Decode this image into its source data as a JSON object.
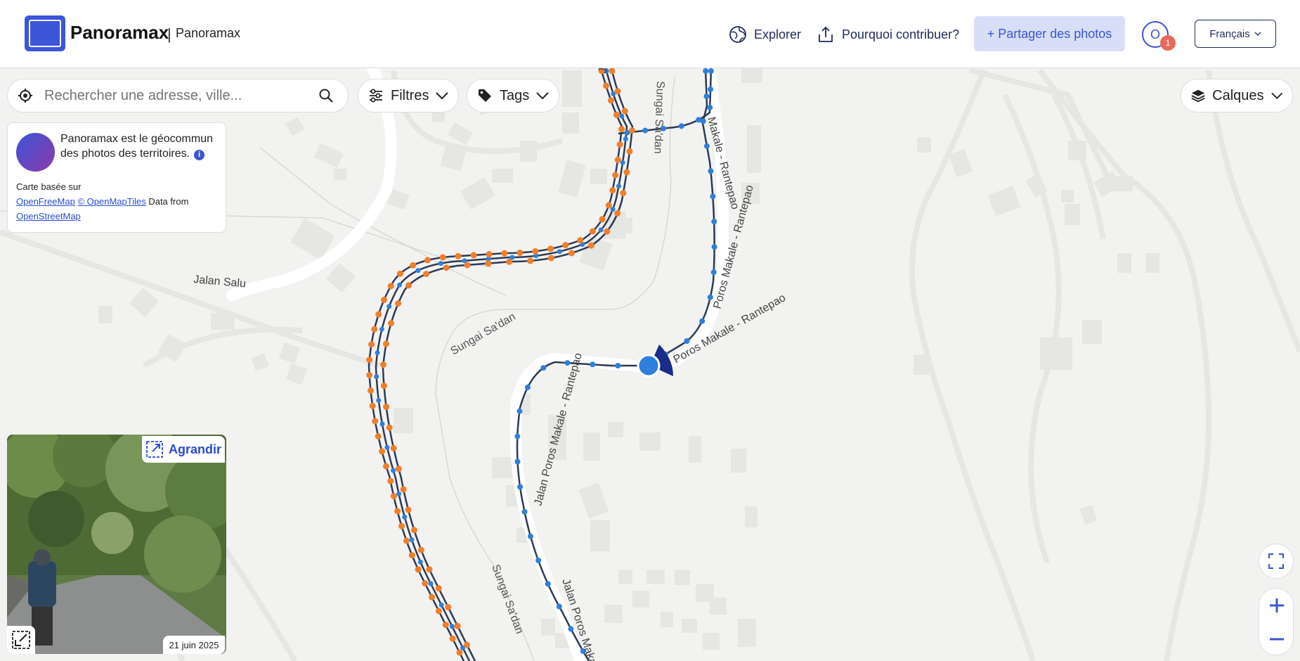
{
  "header": {
    "brand": "Panoramax",
    "brand_sub": "Panoramax",
    "nav": [
      {
        "label": "Explorer",
        "icon": "globe-icon"
      },
      {
        "label": "Pourquoi contribuer?",
        "icon": "upload-icon"
      }
    ],
    "share_label": "+ Partager des photos",
    "user_initial": "O",
    "notification_count": "1",
    "language": "Français"
  },
  "search": {
    "placeholder": "Rechercher une adresse, ville..."
  },
  "filters": {
    "filters_label": "Filtres",
    "tags_label": "Tags",
    "layers_label": "Calques"
  },
  "info": {
    "text": "Panoramax est le géocommun des photos des territoires.",
    "credits_prefix": "Carte basée sur",
    "link1": "OpenFreeMap",
    "link2": "© OpenMapTiles",
    "data_from": "Data from",
    "link3": "OpenStreetMap"
  },
  "viewer": {
    "expand_label": "Agrandir",
    "date": "21 juin 2025"
  },
  "map": {
    "labels": {
      "jalan_salu": "Jalan Salu",
      "sungai_1": "Sungai Sa'dan",
      "sungai_2": "Sungai Sa'dan",
      "sungai_3": "Sungai Sa'dan",
      "road_1": "Jalan Poros Makale - Rantepao",
      "road_2": "Jalan Poros Makale - Rantepao",
      "road_3": "Jalan Poros Makale",
      "road_4": "Poros Makale - Rantepao",
      "road_5": "Makale - Rantepao",
      "road_6": "Poros Makale - Rantepao"
    },
    "colors": {
      "sequence_line": "#2b3a55",
      "photo_point_blue": "#2f7fdc",
      "photo_point_orange": "#f07f2a",
      "selected_cone": "#1a2b8c"
    }
  }
}
